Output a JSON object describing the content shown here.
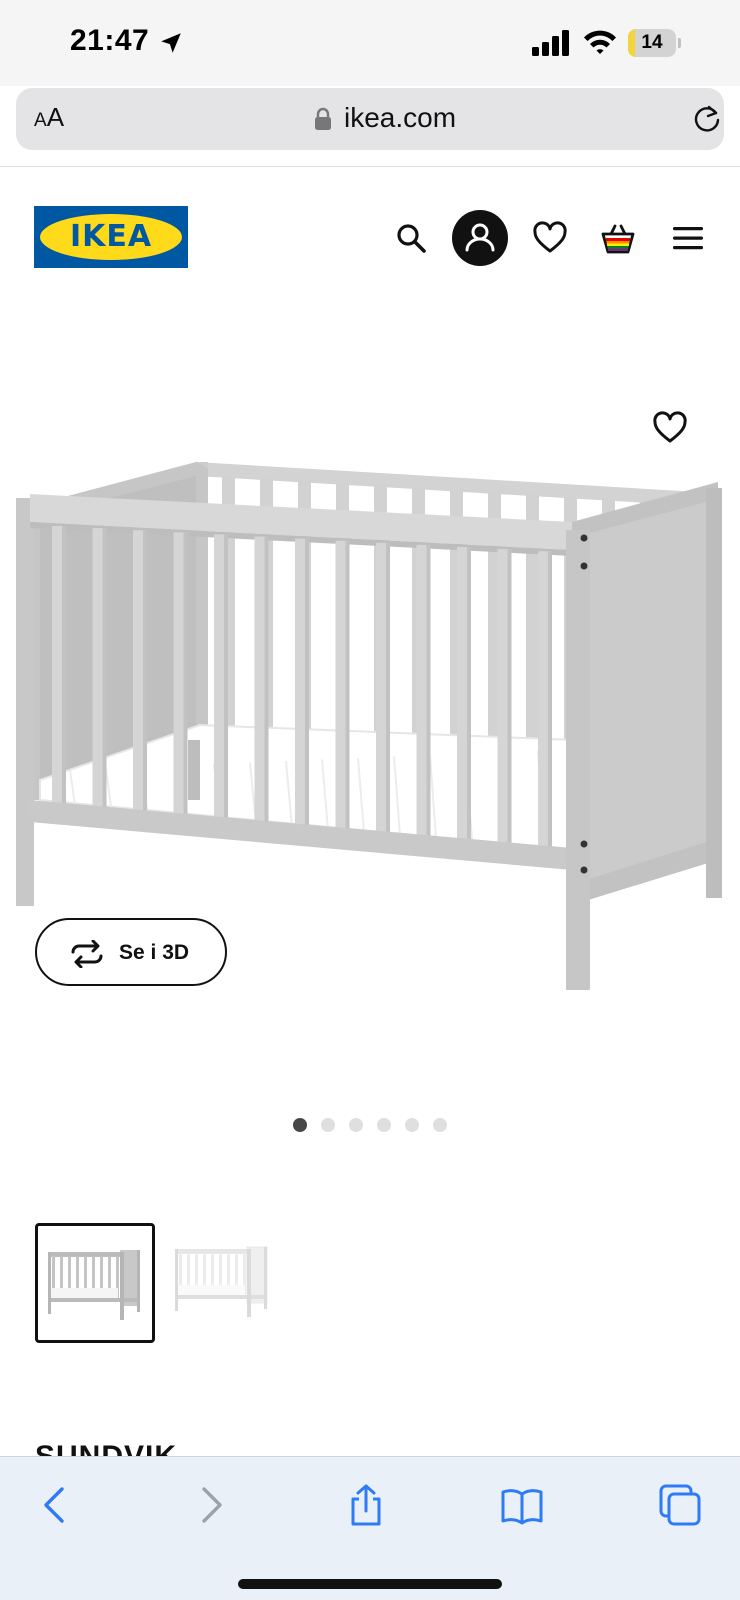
{
  "status_bar": {
    "time": "21:47",
    "battery_level": "14",
    "battery_fraction": 0.14,
    "icons": [
      "location-arrow-icon",
      "cellular-signal-icon",
      "wifi-icon",
      "battery-icon"
    ]
  },
  "address_bar": {
    "text_size_button": "AA",
    "url": "ikea.com",
    "icons": [
      "lock-icon",
      "reload-icon"
    ]
  },
  "header": {
    "logo_text": "IKEA",
    "icons": [
      "search-icon",
      "profile-icon",
      "heart-icon",
      "shopping-bag-icon",
      "hamburger-menu-icon"
    ]
  },
  "product": {
    "name": "SUNDVIK",
    "view_3d_label": "Se i 3D",
    "gallery_page_count": 6,
    "gallery_active_index": 0,
    "color_variants": [
      {
        "name": "grey",
        "selected": true
      },
      {
        "name": "white",
        "selected": false
      }
    ]
  },
  "bottom_toolbar": {
    "icons": [
      "back-icon",
      "forward-icon",
      "share-icon",
      "bookmarks-icon",
      "tabs-icon"
    ]
  },
  "colors": {
    "ikea_blue": "#0058a3",
    "ikea_yellow": "#ffda1a",
    "crib_grey": "#cfcfcf",
    "safari_blue": "#2f7bf6"
  }
}
